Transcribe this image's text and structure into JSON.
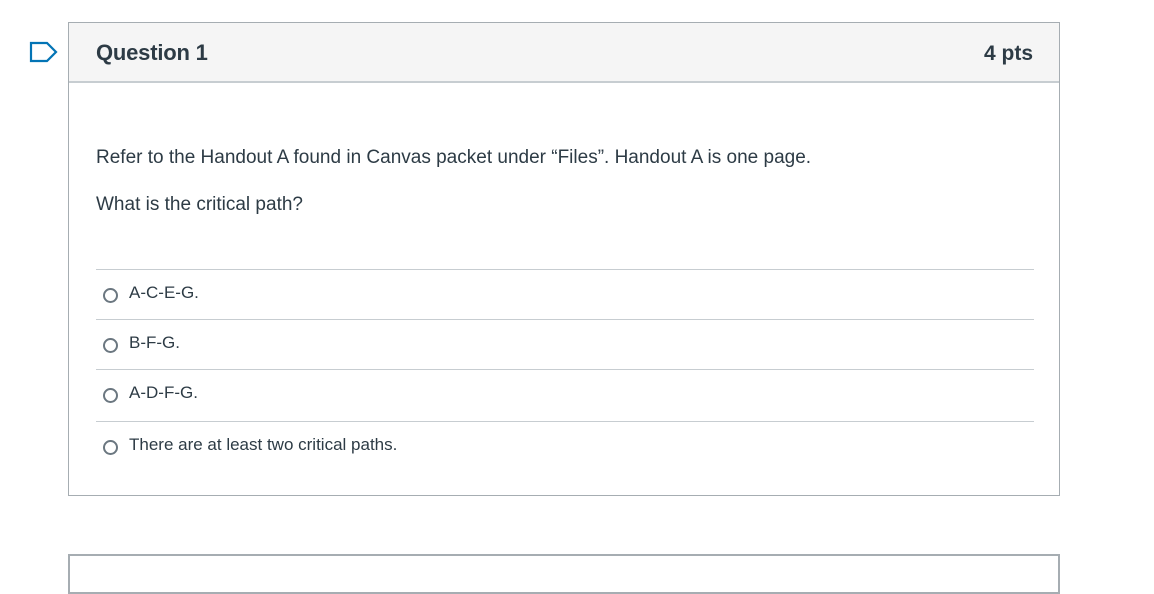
{
  "question": {
    "name": "Question 1",
    "points": "4 pts",
    "text_line1": "Refer to the Handout A found in Canvas packet under “Files”.  Handout A is one page.",
    "text_line2": "What is the critical path?",
    "answers": [
      {
        "label": "A-C-E-G."
      },
      {
        "label": "B-F-G."
      },
      {
        "label": "A-D-F-G."
      },
      {
        "label": "There are at least two critical paths."
      }
    ]
  },
  "colors": {
    "flag": "#0374b5",
    "header_bg": "#f5f5f5",
    "border": "#c7cdd1",
    "text": "#2d3b45"
  },
  "icons": {
    "flag": "flag-question-icon",
    "radio": "radio-button-icon"
  }
}
